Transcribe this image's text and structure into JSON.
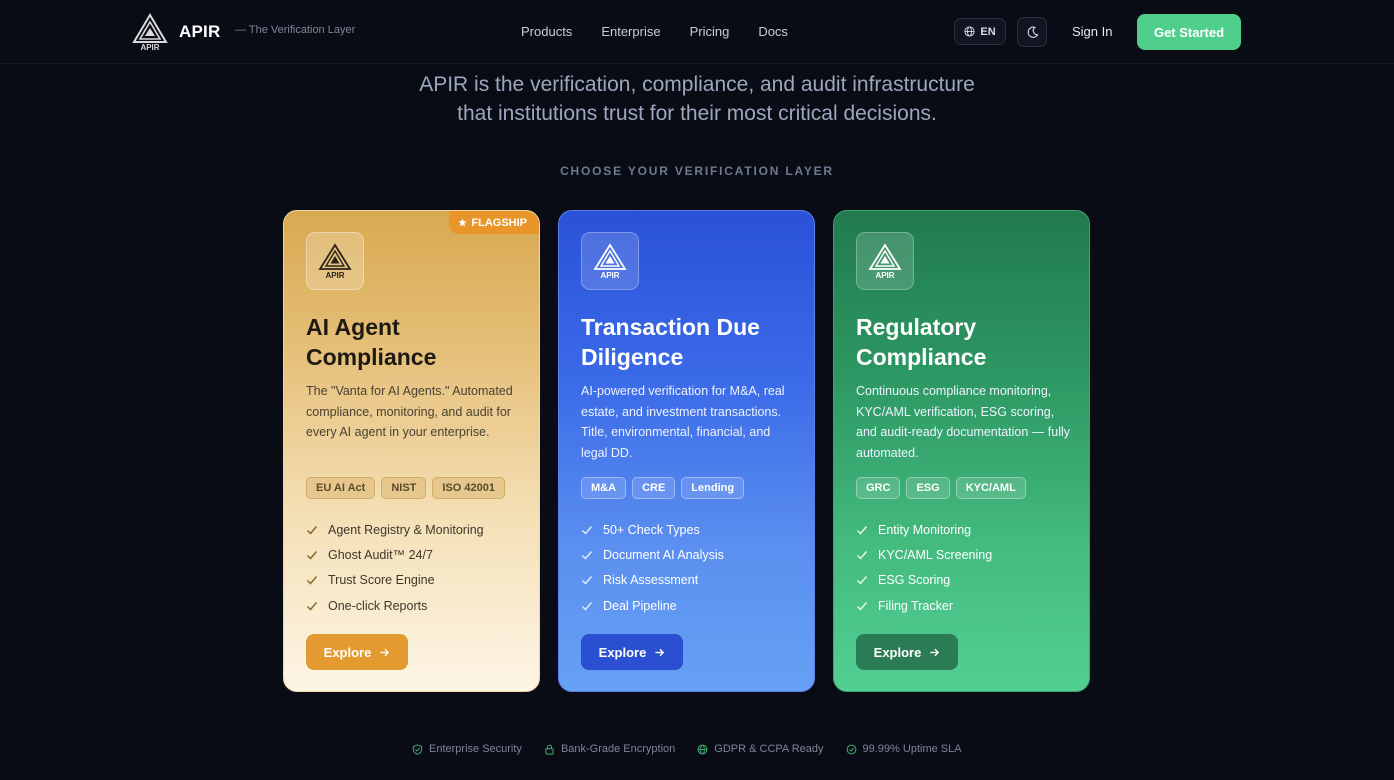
{
  "nav": {
    "brand": "APIR",
    "logo_text": "APIR",
    "tagline": "— The Verification Layer",
    "links": [
      "Products",
      "Enterprise",
      "Pricing",
      "Docs"
    ],
    "language": "EN",
    "theme_icon": "moon-icon",
    "sign_in": "Sign In",
    "get_started": "Get Started"
  },
  "hero": {
    "line1": "APIR is the verification, compliance, and audit infrastructure",
    "line2": "that institutions trust for their most critical decisions."
  },
  "section_label": "CHOOSE YOUR VERIFICATION LAYER",
  "cards": [
    {
      "badge": "FLAGSHIP",
      "logo_text": "APIR",
      "title_line1": "AI Agent",
      "title_line2": "Compliance",
      "desc": "The \"Vanta for AI Agents.\" Automated compliance, monitoring, and audit for every AI agent in your enterprise.",
      "tags": [
        "EU AI Act",
        "NIST",
        "ISO 42001"
      ],
      "features": [
        "Agent Registry & Monitoring",
        "Ghost Audit™ 24/7",
        "Trust Score Engine",
        "One-click Reports"
      ],
      "cta": "Explore",
      "accent": "#e29a31"
    },
    {
      "logo_text": "APIR",
      "title_line1": "Transaction Due",
      "title_line2": "Diligence",
      "desc": "AI-powered verification for M&A, real estate, and investment transactions. Title, environmental, financial, and legal DD.",
      "tags": [
        "M&A",
        "CRE",
        "Lending"
      ],
      "features": [
        "50+ Check Types",
        "Document AI Analysis",
        "Risk Assessment",
        "Deal Pipeline"
      ],
      "cta": "Explore",
      "accent": "#2a4fd0"
    },
    {
      "logo_text": "APIR",
      "title_line1": "Regulatory",
      "title_line2": "Compliance",
      "desc": "Continuous compliance monitoring, KYC/AML verification, ESG scoring, and audit-ready documentation — fully automated.",
      "tags": [
        "GRC",
        "ESG",
        "KYC/AML"
      ],
      "features": [
        "Entity Monitoring",
        "KYC/AML Screening",
        "ESG Scoring",
        "Filing Tracker"
      ],
      "cta": "Explore",
      "accent": "#2b7c55"
    }
  ],
  "trust": [
    {
      "label": "Enterprise Security",
      "icon": "shield-icon"
    },
    {
      "label": "Bank-Grade Encryption",
      "icon": "lock-icon"
    },
    {
      "label": "GDPR & CCPA Ready",
      "icon": "globe-icon"
    },
    {
      "label": "99.99% Uptime SLA",
      "icon": "check-circle-icon"
    }
  ],
  "colors": {
    "background": "#090c15",
    "primary_cta": "#4fce8c",
    "trust_icon": "#3fae6f"
  }
}
